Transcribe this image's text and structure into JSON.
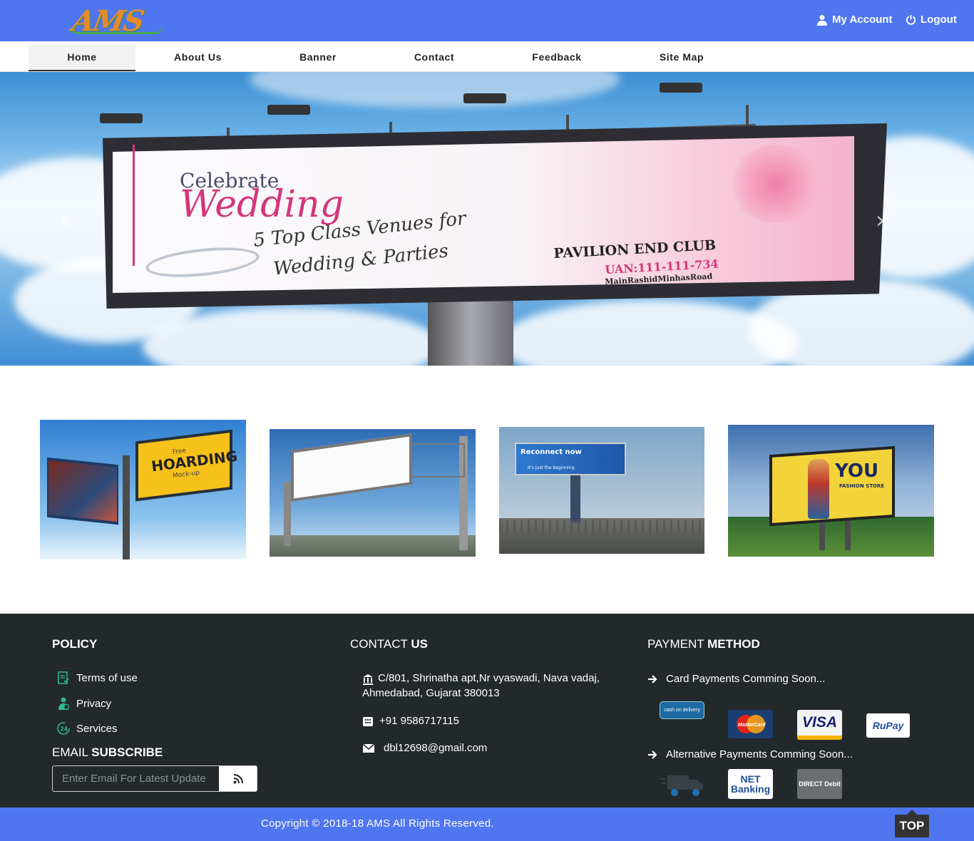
{
  "header": {
    "logo_text": "AMS",
    "my_account": "My Account",
    "logout": "Logout"
  },
  "nav": {
    "items": [
      {
        "label": "Home",
        "active": true
      },
      {
        "label": "About Us"
      },
      {
        "label": "Banner"
      },
      {
        "label": "Contact"
      },
      {
        "label": "Feedback"
      },
      {
        "label": "Site Map"
      }
    ]
  },
  "hero": {
    "line1": "Celebrate",
    "line2": "Wedding",
    "line3": "5 Top Class Venues for",
    "line4": "Wedding & Parties",
    "club": "PAVILION END CLUB",
    "uan": "UAN:111-111-734",
    "road": "MainRashidMinhasRoad",
    "prev_arrow": "‹",
    "next_arrow": "›"
  },
  "thumbnails": [
    {
      "title": "HOARDING",
      "sub_top": "Free",
      "sub_bottom": "Mock-up"
    },
    {
      "title": ""
    },
    {
      "title": "Reconnect now",
      "sub": "It's just the beginning."
    },
    {
      "title": "YOU",
      "sub": "FASHION STORE"
    }
  ],
  "footer": {
    "policy": {
      "heading": "POLICY",
      "links": [
        "Terms of use",
        "Privacy",
        "Services"
      ]
    },
    "email": {
      "heading_light": "EMAIL",
      "heading_bold": "SUBSCRIBE",
      "placeholder": "Enter Email For Latest Update"
    },
    "contact": {
      "heading_light": "CONTACT",
      "heading_bold": "US",
      "address_line1": "C/801, Shrinatha apt,Nr vyaswadi,   Nava vadaj,",
      "address_line2": "Ahmedabad, Gujarat 380013",
      "phone": "+91 9586717115",
      "email": "dbl12698@gmail.com"
    },
    "payment": {
      "heading_light": "PAYMENT",
      "heading_bold": "METHOD",
      "card_note": "Card Payments Comming Soon...",
      "alt_note": "Alternative Payments Comming Soon...",
      "cards": [
        "cash on delivery",
        "MasterCard",
        "VISA",
        "RuPay"
      ],
      "alt": [
        "NET Banking",
        "DIRECT Debit"
      ]
    }
  },
  "bottom": {
    "copyright": "Copyright © 2018-18 AMS All Rights Reserved.",
    "top_button": "TOP"
  },
  "colors": {
    "brand_blue": "#4f76ef",
    "footer_dark": "#23282b"
  }
}
